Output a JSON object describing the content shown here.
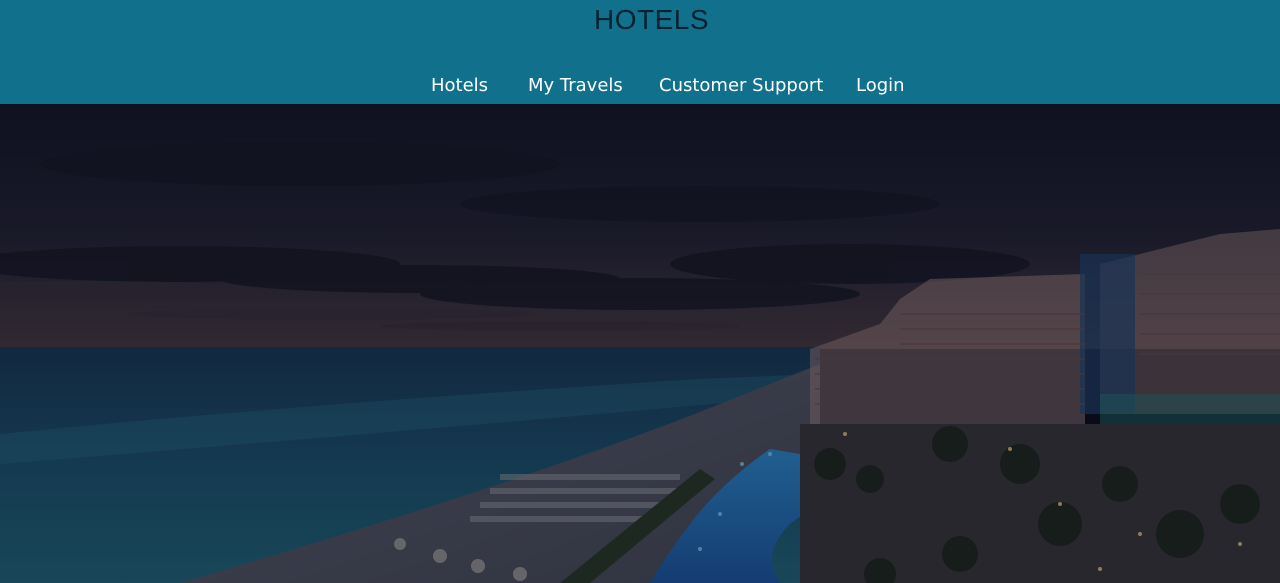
{
  "header": {
    "brand": "HOTELS",
    "nav": [
      {
        "label": "Hotels"
      },
      {
        "label": "My Travels"
      },
      {
        "label": "Customer Support"
      },
      {
        "label": "Login"
      }
    ]
  },
  "theme": {
    "header_bg": "#11718c",
    "brand_color": "#0a2230",
    "nav_color": "#ffffff"
  },
  "hero": {
    "image": "resort-beach-at-dusk"
  }
}
